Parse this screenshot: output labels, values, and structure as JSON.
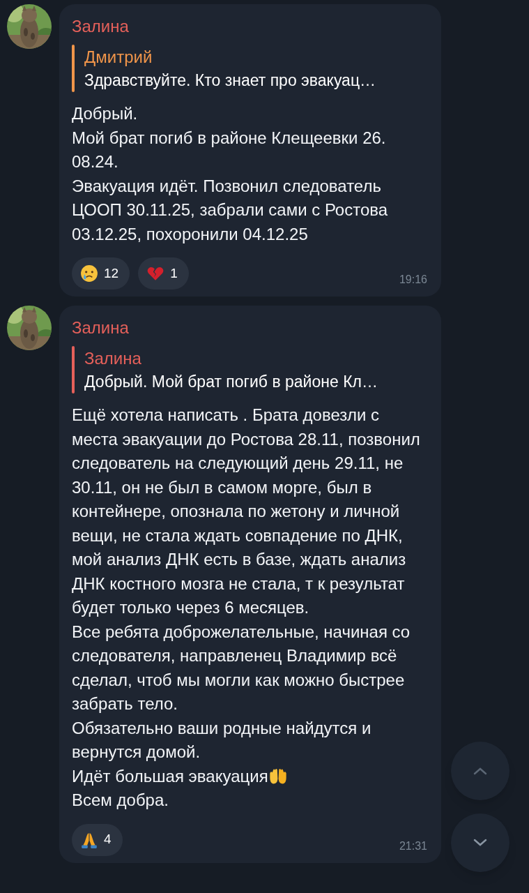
{
  "messages": [
    {
      "sender": "Залина",
      "reply": {
        "sender": "Дмитрий",
        "text": "Здравствуйте. Кто знает про эвакуац…",
        "color": "#f0954a"
      },
      "paragraphs": [
        {
          "kind": "text",
          "text": "Добрый."
        },
        {
          "kind": "text",
          "text": "Мой брат погиб в районе Клещеевки 26. 08.24."
        },
        {
          "kind": "text",
          "text": "Эвакуация идёт. Позвонил следователь ЦООП 30.11.25, забрали сами с Ростова 03.12.25, похоронили 04.12.25"
        }
      ],
      "reactions": [
        {
          "kind": "crying-face",
          "count": "12"
        },
        {
          "kind": "broken-heart",
          "count": "1"
        }
      ],
      "time": "19:16"
    },
    {
      "sender": "Залина",
      "reply": {
        "sender": "Залина",
        "text": "Добрый. Мой брат погиб в районе Кл…",
        "color": "#e5605a"
      },
      "paragraphs": [
        {
          "kind": "text",
          "text": "Ещё хотела написать . Брата довезли с места эвакуации до Ростова 28.11, позвонил следователь на следующий день 29.11,  не 30.11, он не был  в самом морге, был в контейнере, опознала по жетону и личной вещи, не стала ждать совпадение по ДНК,  мой анализ ДНК есть в базе, ждать анализ ДНК костного мозга не стала, т к результат будет только через 6 месяцев."
        },
        {
          "kind": "text",
          "text": "Все ребята доброжелательные, начиная со следователя, направленец Владимир всё сделал, чтоб мы могли как можно быстрее забрать тело."
        },
        {
          "kind": "text",
          "text": "Обязательно ваши родные найдутся и вернутся домой."
        },
        {
          "kind": "emoji",
          "text": "Идёт большая эвакуация"
        },
        {
          "kind": "text",
          "text": "Всем добра."
        }
      ],
      "reactions": [
        {
          "kind": "praying-hands",
          "count": "4"
        }
      ],
      "time": "21:31"
    }
  ]
}
